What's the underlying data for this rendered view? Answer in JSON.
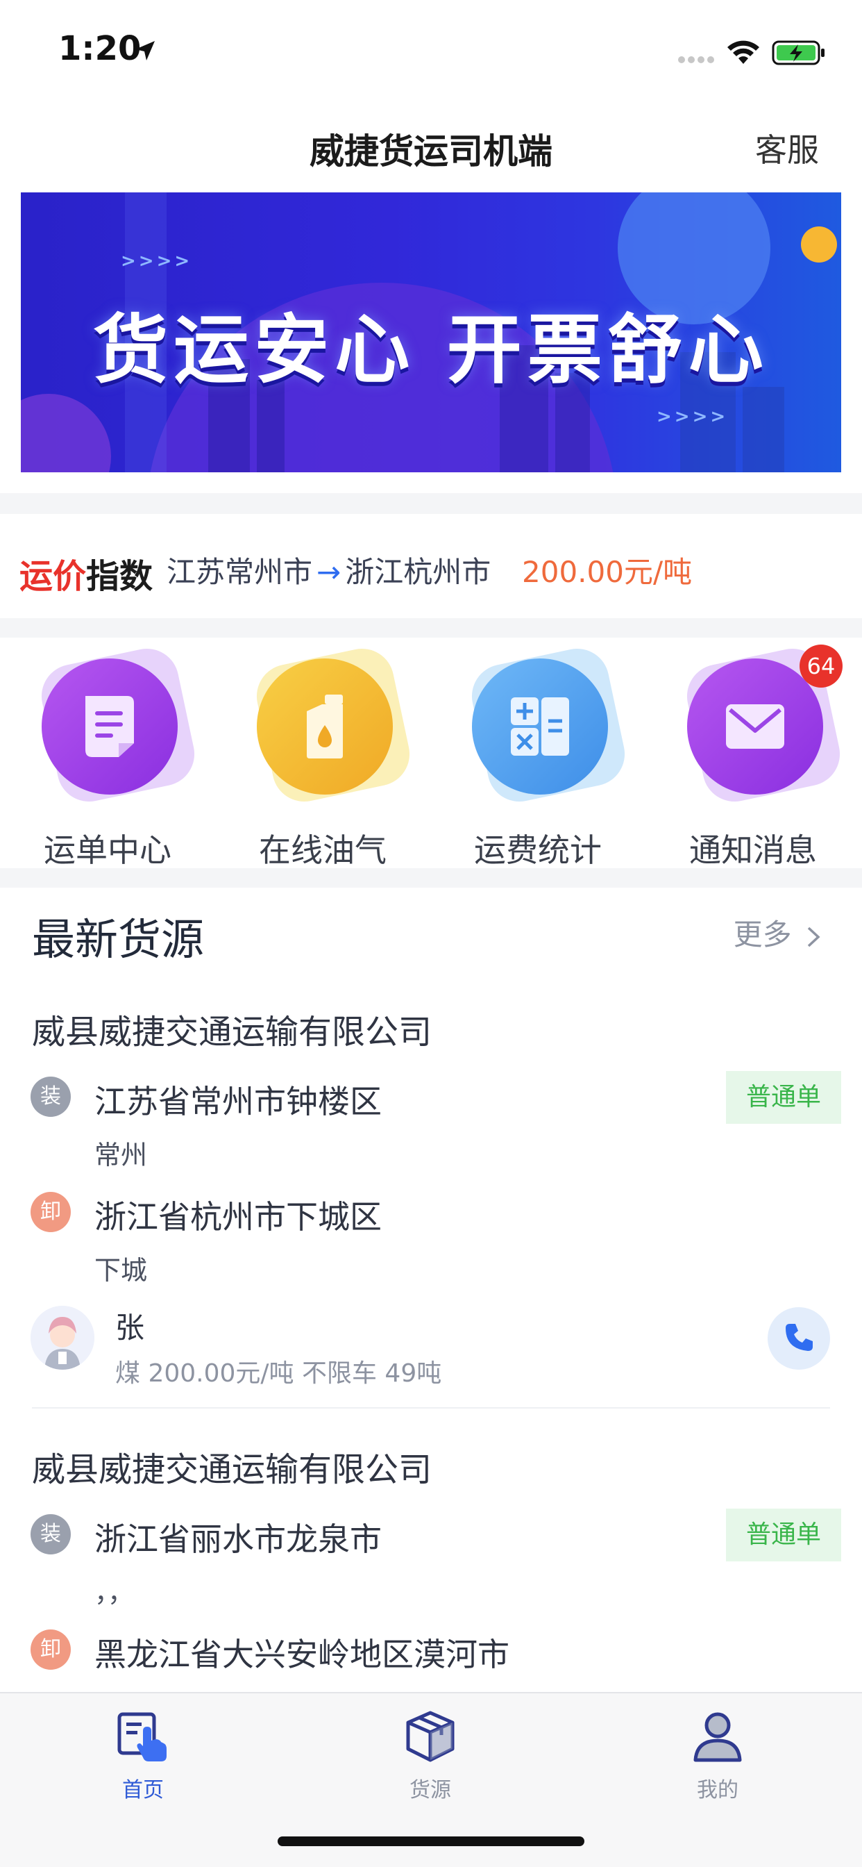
{
  "status": {
    "time": "1:20"
  },
  "nav": {
    "title": "威捷货运司机端",
    "service": "客服"
  },
  "banner": {
    "slogan": "货运安心  开票舒心",
    "arrows": ">>>>"
  },
  "price_index": {
    "logo_red": "运价",
    "logo_dark": "指数",
    "from": "江苏常州市",
    "arrow": "→",
    "to": "浙江杭州市",
    "price": "200.00元/吨"
  },
  "menu": {
    "items": [
      {
        "label": "运单中心"
      },
      {
        "label": "在线油气"
      },
      {
        "label": "运费统计"
      },
      {
        "label": "通知消息",
        "badge": "64"
      }
    ]
  },
  "latest": {
    "title": "最新货源",
    "more": "更多"
  },
  "cargo": [
    {
      "company": "威县威捷交通运输有限公司",
      "load_mark": "装",
      "load_addr": "江苏省常州市钟楼区",
      "load_sub": "常州",
      "tag": "普通单",
      "unload_mark": "卸",
      "unload_addr": "浙江省杭州市下城区",
      "unload_sub": "下城",
      "contact": "张",
      "meta": "煤 200.00元/吨 不限车 49吨"
    },
    {
      "company": "威县威捷交通运输有限公司",
      "load_mark": "装",
      "load_addr": "浙江省丽水市龙泉市",
      "load_sub": "，，",
      "tag": "普通单",
      "unload_mark": "卸",
      "unload_addr": "黑龙江省大兴安岭地区漠河市"
    }
  ],
  "tabbar": {
    "tabs": [
      {
        "label": "首页",
        "icon": "home-touch-icon",
        "active": true
      },
      {
        "label": "货源",
        "icon": "box-icon",
        "active": false
      },
      {
        "label": "我的",
        "icon": "user-icon",
        "active": false
      }
    ]
  },
  "colors": {
    "accent_blue": "#2f5bd6",
    "price_orange": "#ef6a3c",
    "badge_red": "#e8322b",
    "tag_green": "#39b54a"
  }
}
